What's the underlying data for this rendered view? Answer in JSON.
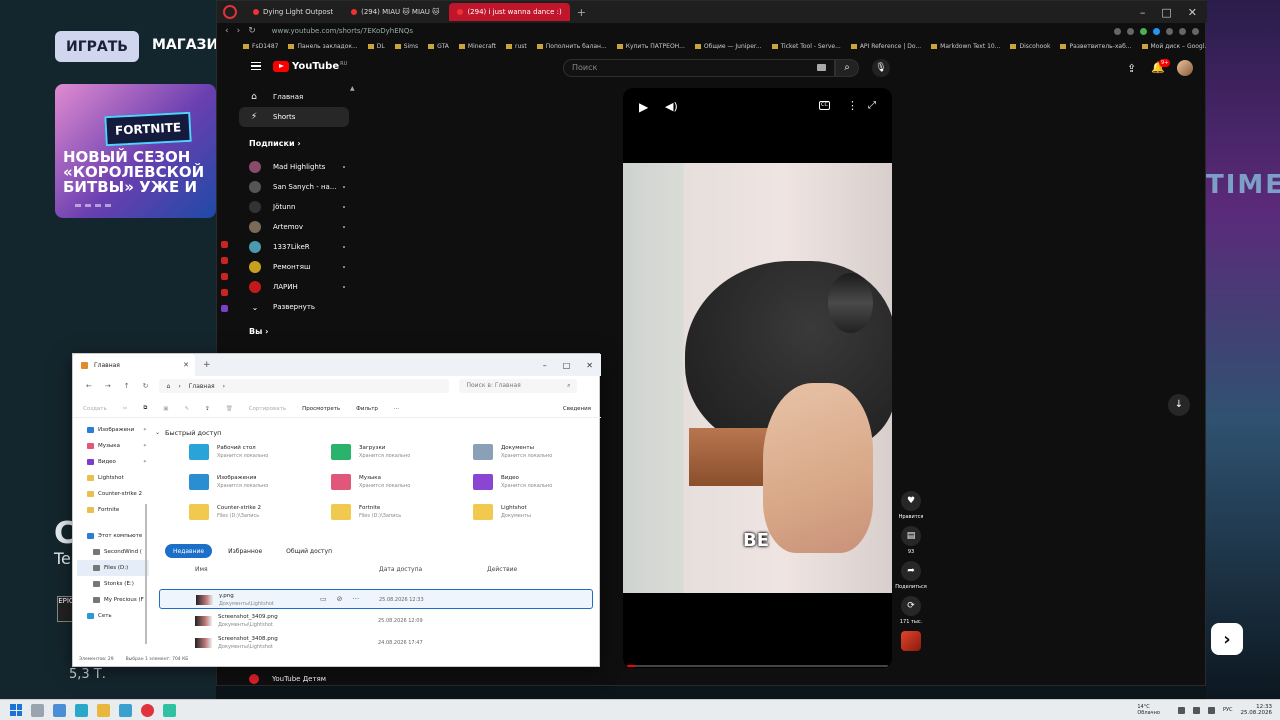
{
  "background": {
    "play_button": "ИГРАТЬ",
    "shop_tab": "МАГАЗИ",
    "promo_logo": "FORTNITE",
    "promo_text": "НОВЫЙ СЕЗОН «КОРОЛЕВСКОЙ БИТВЫ» УЖЕ И",
    "left_big": "С",
    "left_sub": "Te",
    "left_price": "5,3 Т.",
    "right_neon": "TIME",
    "next_arrow": "›"
  },
  "browser": {
    "tabs": [
      {
        "label": "Dying Light Outpost",
        "active": false
      },
      {
        "label": "(294) MIAU 🐱 MIAU 🐱",
        "active": false
      },
      {
        "label": "(294) i just wanna dance :)",
        "active": true
      }
    ],
    "url": "www.youtube.com/shorts/7EKoDyhENQs",
    "bookmarks": [
      "FsD1487",
      "Панель закладок...",
      "DL",
      "Sims",
      "GTA",
      "Minecraft",
      "rust",
      "Пополнить балан...",
      "Купить ПАТРЕОН...",
      "Общие — Juniper...",
      "Ticket Tool - Serve...",
      "API Reference | Do...",
      "Markdown Text 10...",
      "Discohook",
      "Разветвитель-хаб...",
      "Мой диск – Googl..."
    ]
  },
  "youtube": {
    "logo_text": "YouTube",
    "logo_region": "RU",
    "search_placeholder": "Поиск",
    "notif_count": "9+",
    "nav": [
      {
        "label": "Главная",
        "icon": "⌂",
        "selected": false
      },
      {
        "label": "Shorts",
        "icon": "⚡",
        "selected": true
      }
    ],
    "subs_title": "Подписки  ›",
    "subscriptions": [
      {
        "name": "Mad Highlights",
        "color": "#8a4a6a"
      },
      {
        "name": "San Sanych - на...",
        "color": "#555555"
      },
      {
        "name": "Jötunn",
        "color": "#333333"
      },
      {
        "name": "Artemov",
        "color": "#7a6a5a"
      },
      {
        "name": "1337LikeR",
        "color": "#4a9ab0"
      },
      {
        "name": "Ремонтяш",
        "color": "#c8a020"
      },
      {
        "name": "ЛАРИН",
        "color": "#c21a1a"
      }
    ],
    "expand_label": "Развернуть",
    "you_label": "Вы  ›",
    "kids_label": "YouTube Детям"
  },
  "short": {
    "caption": "BE",
    "progress_fraction": 0.03,
    "like_label": "Нравится",
    "comments_count": "93",
    "share_label": "Поделиться",
    "remix_count": "171 тыс."
  },
  "explorer": {
    "tab_title": "Главная",
    "crumb": "Главная",
    "search_placeholder": "Поиск в: Главная",
    "toolbar": {
      "create": "Создать",
      "sort": "Сортировать",
      "view": "Просмотреть",
      "filter": "Фильтр",
      "details": "Сведения"
    },
    "left_items": [
      {
        "label": "Изображени",
        "color": "#2a7fd4",
        "pin": true
      },
      {
        "label": "Музыка",
        "color": "#e0577a",
        "pin": true
      },
      {
        "label": "Видео",
        "color": "#7b3fc8",
        "pin": true
      },
      {
        "label": "Lightshot",
        "color": "#e8c050",
        "pin": false
      },
      {
        "label": "Counter-strike 2",
        "color": "#e8c050",
        "pin": false
      },
      {
        "label": "Fortnite",
        "color": "#e8c050",
        "pin": false
      }
    ],
    "tree_items": [
      {
        "label": "Этот компьюте",
        "color": "#2a7fd4",
        "indent": false,
        "selected": false
      },
      {
        "label": "SecondWind (",
        "color": "#777777",
        "indent": true,
        "selected": false
      },
      {
        "label": "Files (D:)",
        "color": "#777777",
        "indent": true,
        "selected": true
      },
      {
        "label": "Stonks (E:)",
        "color": "#777777",
        "indent": true,
        "selected": false
      },
      {
        "label": "My Precious (F",
        "color": "#777777",
        "indent": true,
        "selected": false
      },
      {
        "label": "Сеть",
        "color": "#2a9ad4",
        "indent": false,
        "selected": false
      }
    ],
    "quick_access_title": "Быстрый доступ",
    "quick_access": [
      {
        "name": "Рабочий стол",
        "sub": "Хранится локально",
        "color": "#29a3d8"
      },
      {
        "name": "Загрузки",
        "sub": "Хранится локально",
        "color": "#2bb36b"
      },
      {
        "name": "Документы",
        "sub": "Хранится локально",
        "color": "#8aa0b6"
      },
      {
        "name": "Изображения",
        "sub": "Хранится локально",
        "color": "#2a8fd0"
      },
      {
        "name": "Музыка",
        "sub": "Хранится локально",
        "color": "#e0577a"
      },
      {
        "name": "Видео",
        "sub": "Хранится локально",
        "color": "#8a45d2"
      },
      {
        "name": "Counter-strike 2",
        "sub": "Files (D:)\\Запись",
        "color": "#f0c94e"
      },
      {
        "name": "Fortnite",
        "sub": "Files (D:)\\Запись",
        "color": "#f0c94e"
      },
      {
        "name": "Lightshot",
        "sub": "Документы",
        "color": "#f0c94e"
      }
    ],
    "recent_tabs": [
      "Недавние",
      "Избранное",
      "Общий доступ"
    ],
    "columns": {
      "name": "Имя",
      "date": "Дата доступа",
      "action": "Действие"
    },
    "recent_files": [
      {
        "name": "y.png",
        "path": "Документы\\Lightshot",
        "date": "25.08.2026 12:33",
        "selected": true
      },
      {
        "name": "Screenshot_3409.png",
        "path": "Документы\\Lightshot",
        "date": "25.08.2026 12:09",
        "selected": false
      },
      {
        "name": "Screenshot_3408.png",
        "path": "Документы\\Lightshot",
        "date": "24.08.2026 17:47",
        "selected": false
      }
    ],
    "status_items": "Элементов: 29",
    "status_selected": "Выбран 1 элемент: 704 КБ"
  },
  "taskbar": {
    "weather_temp": "14°C",
    "weather_desc": "Облачно",
    "lang": "РУС",
    "time": "12:33",
    "date": "25.08.2026"
  }
}
